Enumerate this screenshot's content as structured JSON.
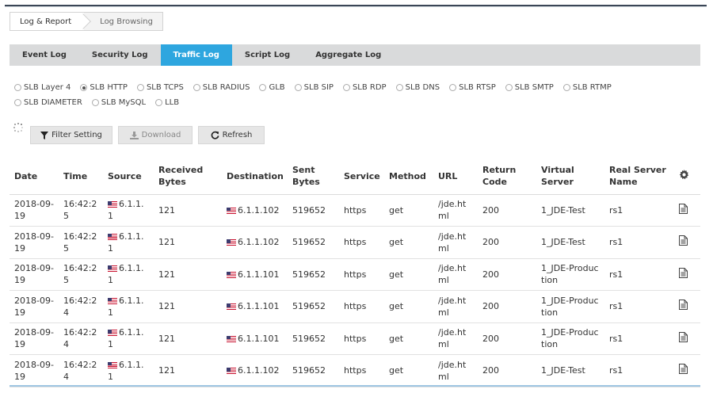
{
  "breadcrumb": {
    "item1": "Log & Report",
    "item2": "Log Browsing"
  },
  "tabs": [
    "Event Log",
    "Security Log",
    "Traffic Log",
    "Script Log",
    "Aggregate Log"
  ],
  "active_tab": "Traffic Log",
  "log_types": [
    {
      "label": "SLB Layer 4",
      "checked": false
    },
    {
      "label": "SLB HTTP",
      "checked": true
    },
    {
      "label": "SLB TCPS",
      "checked": false
    },
    {
      "label": "SLB RADIUS",
      "checked": false
    },
    {
      "label": "GLB",
      "checked": false
    },
    {
      "label": "SLB SIP",
      "checked": false
    },
    {
      "label": "SLB RDP",
      "checked": false
    },
    {
      "label": "SLB DNS",
      "checked": false
    },
    {
      "label": "SLB RTSP",
      "checked": false
    },
    {
      "label": "SLB SMTP",
      "checked": false
    },
    {
      "label": "SLB RTMP",
      "checked": false
    },
    {
      "label": "SLB DIAMETER",
      "checked": false
    },
    {
      "label": "SLB MySQL",
      "checked": false
    },
    {
      "label": "LLB",
      "checked": false
    }
  ],
  "buttons": {
    "filter": "Filter Setting",
    "download": "Download",
    "refresh": "Refresh"
  },
  "icons": {
    "filter": "filter-icon",
    "download": "download-icon",
    "refresh": "refresh-icon",
    "settings": "gear-icon",
    "detail": "document-icon",
    "flag": "us-flag-icon",
    "loading": "spinner-icon"
  },
  "table": {
    "columns": [
      "Date",
      "Time",
      "Source",
      "Received Bytes",
      "Destination",
      "Sent Bytes",
      "Service",
      "Method",
      "URL",
      "Return Code",
      "Virtual Server",
      "Real Server Name"
    ],
    "rows": [
      [
        "2018-09-19",
        "16:42:25",
        "6.1.1.1",
        "121",
        "6.1.1.102",
        "519652",
        "https",
        "get",
        "/jde.html",
        "200",
        "1_JDE-Test",
        "rs1"
      ],
      [
        "2018-09-19",
        "16:42:25",
        "6.1.1.1",
        "121",
        "6.1.1.102",
        "519652",
        "https",
        "get",
        "/jde.html",
        "200",
        "1_JDE-Test",
        "rs1"
      ],
      [
        "2018-09-19",
        "16:42:25",
        "6.1.1.1",
        "121",
        "6.1.1.101",
        "519652",
        "https",
        "get",
        "/jde.html",
        "200",
        "1_JDE-Production",
        "rs1"
      ],
      [
        "2018-09-19",
        "16:42:24",
        "6.1.1.1",
        "121",
        "6.1.1.101",
        "519652",
        "https",
        "get",
        "/jde.html",
        "200",
        "1_JDE-Production",
        "rs1"
      ],
      [
        "2018-09-19",
        "16:42:24",
        "6.1.1.1",
        "121",
        "6.1.1.101",
        "519652",
        "https",
        "get",
        "/jde.html",
        "200",
        "1_JDE-Production",
        "rs1"
      ],
      [
        "2018-09-19",
        "16:42:24",
        "6.1.1.1",
        "121",
        "6.1.1.102",
        "519652",
        "https",
        "get",
        "/jde.html",
        "200",
        "1_JDE-Test",
        "rs1"
      ]
    ]
  },
  "colors": {
    "accent": "#2ea6df",
    "tabbar": "#d9dadb",
    "button": "#e6e6e6"
  }
}
